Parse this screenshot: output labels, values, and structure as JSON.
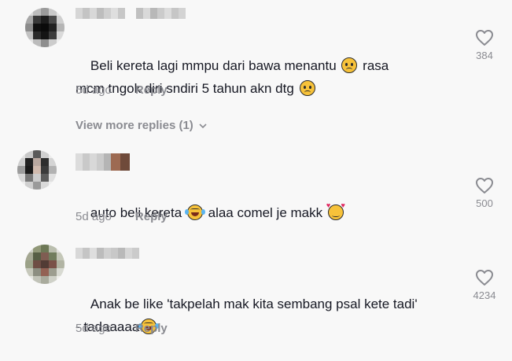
{
  "comments": [
    {
      "text_line1": "Beli kereta lagi mmpu dari bawa menantu",
      "text_line1b": "rasa",
      "text_line2": "mcm tngok diri sndiri 5 tahun akn dtg",
      "time": "5d ago",
      "reply_label": "Reply",
      "likes": "384",
      "emojis": [
        "sad-face-icon",
        "sad-face-icon"
      ]
    },
    {
      "text_a": "auto beli kereta",
      "text_b": "alaa comel je makk",
      "time": "5d ago",
      "reply_label": "Reply",
      "likes": "500",
      "emojis": [
        "laughing-tears-icon",
        "smiling-hearts-icon"
      ]
    },
    {
      "text_line1": "Anak be like 'takpelah mak kita sembang psal kete tadi'",
      "text_line2": "- tadaaaaa",
      "time": "5d ago",
      "reply_label": "Reply",
      "likes": "4234",
      "emojis": [
        "laughing-tears-icon"
      ]
    }
  ],
  "view_more_replies": "View more replies (1)",
  "colors": {
    "background": "#f8f8f8",
    "text": "#161823",
    "muted": "#8a8b91"
  }
}
